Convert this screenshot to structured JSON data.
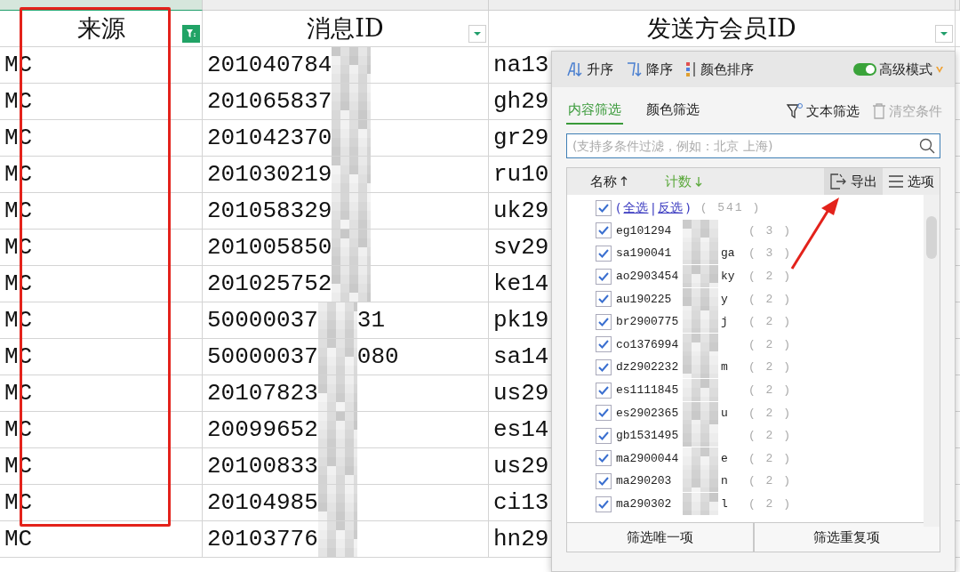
{
  "columns": [
    {
      "header": "来源",
      "filtered": true
    },
    {
      "header": "消息ID",
      "filtered": false
    },
    {
      "header": "发送方会员ID",
      "filtered": false
    }
  ],
  "rows": [
    {
      "source": "MC",
      "message_id": "201040784",
      "sender": "na13"
    },
    {
      "source": "MC",
      "message_id": "201065837",
      "sender": "gh29"
    },
    {
      "source": "MC",
      "message_id": "201042370",
      "sender": "gr29"
    },
    {
      "source": "MC",
      "message_id": "201030219",
      "sender": "ru10"
    },
    {
      "source": "MC",
      "message_id": "201058329",
      "sender": "uk29"
    },
    {
      "source": "MC",
      "message_id": "201005850",
      "sender": "sv29"
    },
    {
      "source": "MC",
      "message_id": "201025752",
      "sender": "ke14"
    },
    {
      "source": "MC",
      "message_id": "50000037",
      "message_id_end": "31",
      "sender": "pk19"
    },
    {
      "source": "MC",
      "message_id": "50000037",
      "message_id_end": "080",
      "sender": "sa14"
    },
    {
      "source": "MC",
      "message_id": "20107823",
      "sender": "us29"
    },
    {
      "source": "MC",
      "message_id": "20099652",
      "sender": "es14"
    },
    {
      "source": "MC",
      "message_id": "20100833",
      "sender": "us29"
    },
    {
      "source": "MC",
      "message_id": "20104985",
      "sender": "ci13"
    },
    {
      "source": "MC",
      "message_id": "20103776",
      "sender": "hn29"
    }
  ],
  "filter_panel": {
    "sort_buttons": [
      {
        "label": "升序",
        "kind": "asc"
      },
      {
        "label": "降序",
        "kind": "desc"
      },
      {
        "label": "颜色排序",
        "kind": "color"
      }
    ],
    "advanced_mode": {
      "label": "高级模式",
      "on": true
    },
    "tabs": [
      {
        "label": "内容筛选",
        "selected": true
      },
      {
        "label": "颜色筛选",
        "selected": false
      }
    ],
    "text_filter": {
      "label": "文本筛选"
    },
    "clear": {
      "label": "清空条件",
      "disabled": true
    },
    "search": {
      "placeholder": "(支持多条件过滤，例如：北京 上海)"
    },
    "list_header": {
      "name": "名称",
      "count": "计数",
      "export": "导出",
      "options": "选项"
    },
    "select_all": {
      "open": "(",
      "all": "全选",
      "separator": "|",
      "invert": "反选",
      "close": ")",
      "count": "( 541 )",
      "checked": true
    },
    "items": [
      {
        "name": "eg101294",
        "count": "( 3 )",
        "checked": true
      },
      {
        "name": "sa190041",
        "name_end": "ga",
        "count": "( 3 )",
        "checked": true
      },
      {
        "name": "ao2903454",
        "name_end": "ky",
        "count": "( 2 )",
        "checked": true
      },
      {
        "name": "au190225",
        "name_end": "y",
        "count": "( 2 )",
        "checked": true
      },
      {
        "name": "br2900775",
        "name_end": "j",
        "count": "( 2 )",
        "checked": true
      },
      {
        "name": "co1376994",
        "count": "( 2 )",
        "checked": true
      },
      {
        "name": "dz2902232",
        "name_end": "m",
        "count": "( 2 )",
        "checked": true
      },
      {
        "name": "es1111845",
        "count": "( 2 )",
        "checked": true
      },
      {
        "name": "es2902365",
        "name_end": "u",
        "count": "( 2 )",
        "checked": true
      },
      {
        "name": "gb1531495",
        "count": "( 2 )",
        "checked": true
      },
      {
        "name": "ma2900044",
        "name_end": "e",
        "count": "( 2 )",
        "checked": true
      },
      {
        "name": "ma290203",
        "name_end": "n",
        "count": "( 2 )",
        "checked": true
      },
      {
        "name": "ma290302",
        "name_end": "l",
        "count": "( 2 )",
        "checked": true
      }
    ],
    "buttons": [
      "筛选唯一项",
      "筛选重复项"
    ]
  }
}
